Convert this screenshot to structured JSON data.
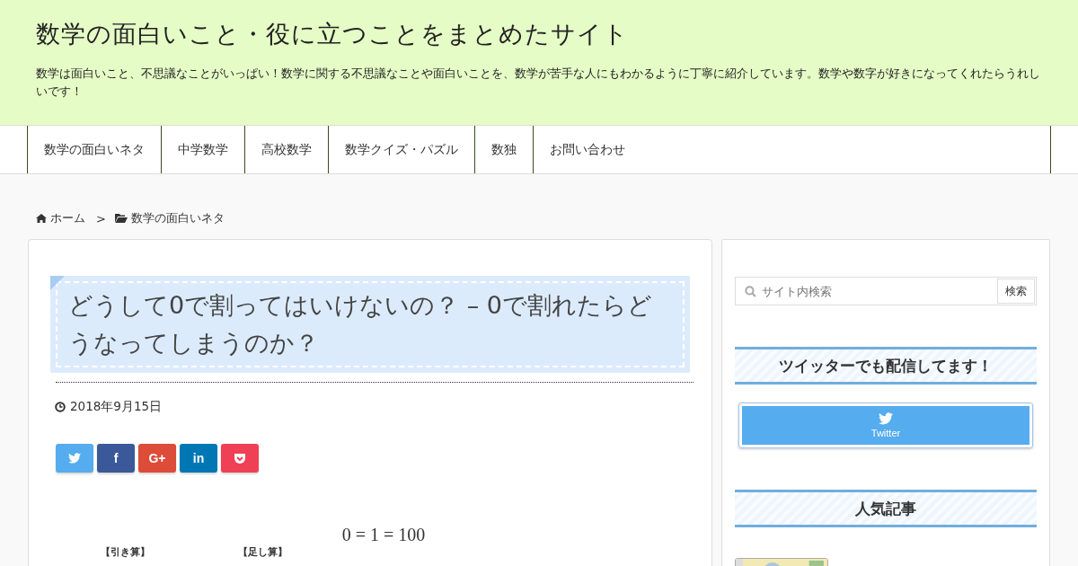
{
  "header": {
    "site_title": "数学の面白いこと・役に立つことをまとめたサイト",
    "description": "数学は面白いこと、不思議なことがいっぱい！数学に関する不思議なことや面白いことを、数学が苦手な人にもわかるように丁寧に紹介しています。数学や数字が好きになってくれたらうれしいです！"
  },
  "nav": [
    "数学の面白いネタ",
    "中学数学",
    "高校数学",
    "数学クイズ・パズル",
    "数独",
    "お問い合わせ"
  ],
  "breadcrumb": [
    {
      "kind": "home",
      "label": "ホーム"
    },
    {
      "kind": "category",
      "label": "数学の面白いネタ"
    }
  ],
  "breadcrumb_separator": ">",
  "article": {
    "title": "どうして0で割ってはいけないの？ – 0で割れたらどうなってしまうのか？",
    "date": "2018年9月15日",
    "share_buttons": [
      {
        "kind": "twitter",
        "color": "#55acee"
      },
      {
        "kind": "facebook",
        "label": "f",
        "color": "#3b5998"
      },
      {
        "kind": "googleplus",
        "label": "G+",
        "color": "#dd4b39"
      },
      {
        "kind": "linkedin",
        "label": "in",
        "color": "#0077b5"
      },
      {
        "kind": "pocket",
        "color": "#ef4056"
      }
    ],
    "equation": "0 = 1 = 100",
    "labels": [
      "【引き算】",
      "【足し算】"
    ]
  },
  "sidebar": {
    "search": {
      "placeholder": "サイト内検索",
      "button": "検索"
    },
    "twitter_heading": "ツイッターでも配信してます！",
    "twitter_button": "Twitter",
    "popular_heading": "人気記事"
  }
}
